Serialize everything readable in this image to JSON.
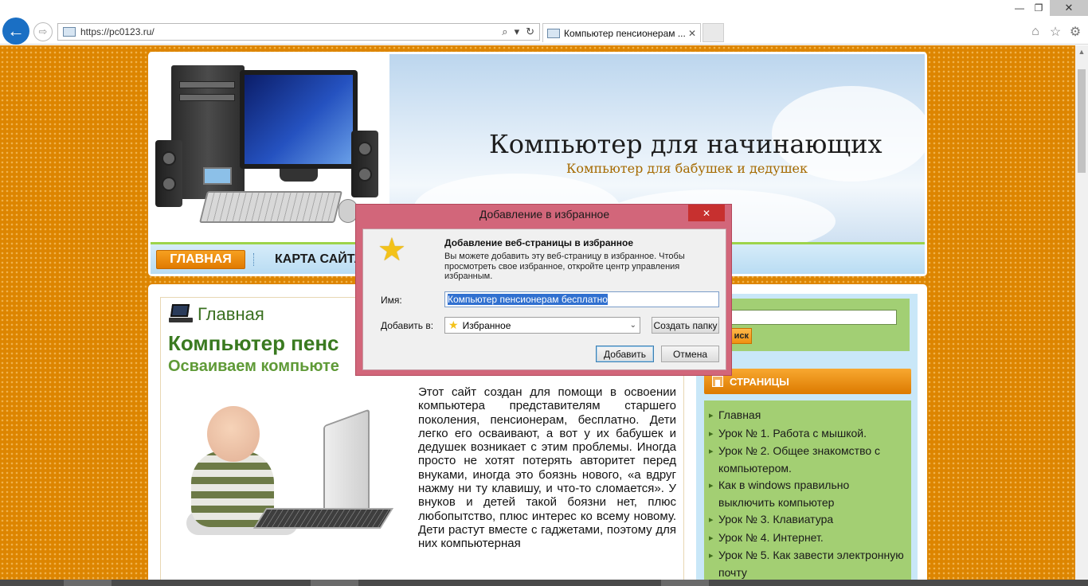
{
  "browser": {
    "url": "https://pc0123.ru/",
    "tab_title": "Компьютер пенсионерам ...",
    "tab_close": "✕",
    "addr_search": "⌕",
    "addr_refresh": "↻",
    "win_min": "—",
    "win_max": "❐",
    "win_close": "✕",
    "icons": [
      "back-arrow-icon",
      "forward-arrow-icon",
      "home-icon",
      "star-icon",
      "gear-icon"
    ],
    "accent_color": "#1a6fc4"
  },
  "site": {
    "title": "Компьютер для начинающих",
    "subtitle": "Компьютер для бабушек и дедушек",
    "nav": [
      {
        "label": "ГЛАВНАЯ",
        "active": true
      },
      {
        "label": "КАРТА САЙТА",
        "active": false
      }
    ],
    "background_color": "#dd8500"
  },
  "article": {
    "breadcrumb": "Главная",
    "heading": "Компьютер пенс",
    "subheading": "Осваиваем компьюте",
    "text": "Этот сайт создан для помощи в освоении компьютера представителям старшего поколения, пенсионерам, бесплатно. Дети легко его осваивают, а вот у их бабушек и дедушек возникает с этим проблемы. Иногда просто не хотят потерять авторитет перед внуками, иногда это боязнь нового, «а вдруг нажму ни ту клавишу, и что-то сломается». У внуков и детей такой боязни нет, плюс любопытство, плюс интерес ко всему новому. Дети растут вместе с гаджетами, поэтому для них компьютерная"
  },
  "sidebar": {
    "search_button": "иск",
    "pages_title": "СТРАНИЦЫ",
    "pages": [
      "Главная",
      "Урок № 1. Работа с мышкой.",
      "Урок № 2. Общее знакомство с компьютером.",
      "Как в windows правильно выключить компьютер",
      "Урок № 3. Клавиатура",
      "Урок № 4. Интернет.",
      "Урок № 5. Как завести электронную почту"
    ]
  },
  "dialog": {
    "title": "Добавление в избранное",
    "close": "✕",
    "heading": "Добавление веб-страницы в избранное",
    "description": "Вы можете добавить эту веб-страницу в избранное. Чтобы просмотреть свое избранное, откройте центр управления избранным.",
    "name_label": "Имя:",
    "name_value": "Компьютер пенсионерам бесплатно",
    "folder_label": "Добавить в:",
    "folder_value": "Избранное",
    "new_folder_button": "Создать папку",
    "add_button": "Добавить",
    "cancel_button": "Отмена",
    "frame_color": "#d2667a"
  }
}
